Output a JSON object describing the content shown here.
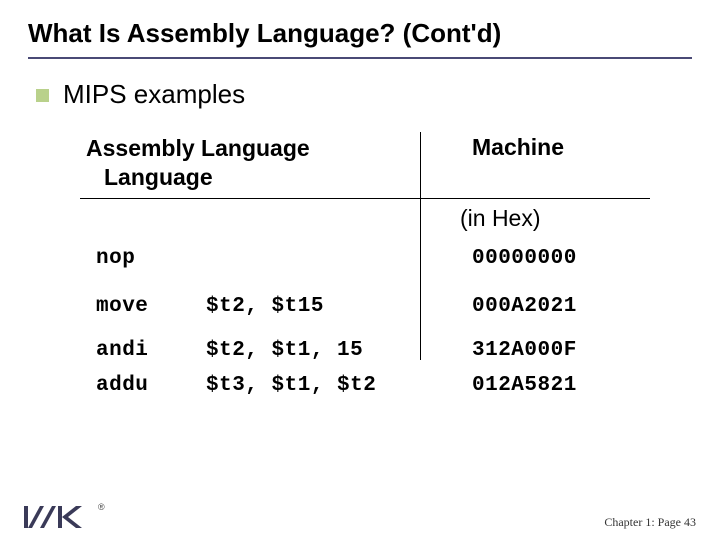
{
  "title": "What Is Assembly Language? (Cont'd)",
  "bullet": "MIPS examples",
  "table": {
    "header_left_l1": "Assembly Language",
    "header_left_l2": "Language",
    "header_right": "Machine",
    "subhead": "(in Hex)",
    "rows": [
      {
        "mnemonic": "nop",
        "operands": "",
        "hex": "00000000"
      },
      {
        "mnemonic": "move",
        "operands": "$t2, $t15",
        "hex": "000A2021"
      },
      {
        "mnemonic": "andi",
        "operands": "$t2, $t1, 15",
        "hex": "312A000F"
      },
      {
        "mnemonic": "addu",
        "operands": "$t3, $t1, $t2",
        "hex": "012A5821"
      }
    ]
  },
  "footer": "Chapter 1: Page 43"
}
